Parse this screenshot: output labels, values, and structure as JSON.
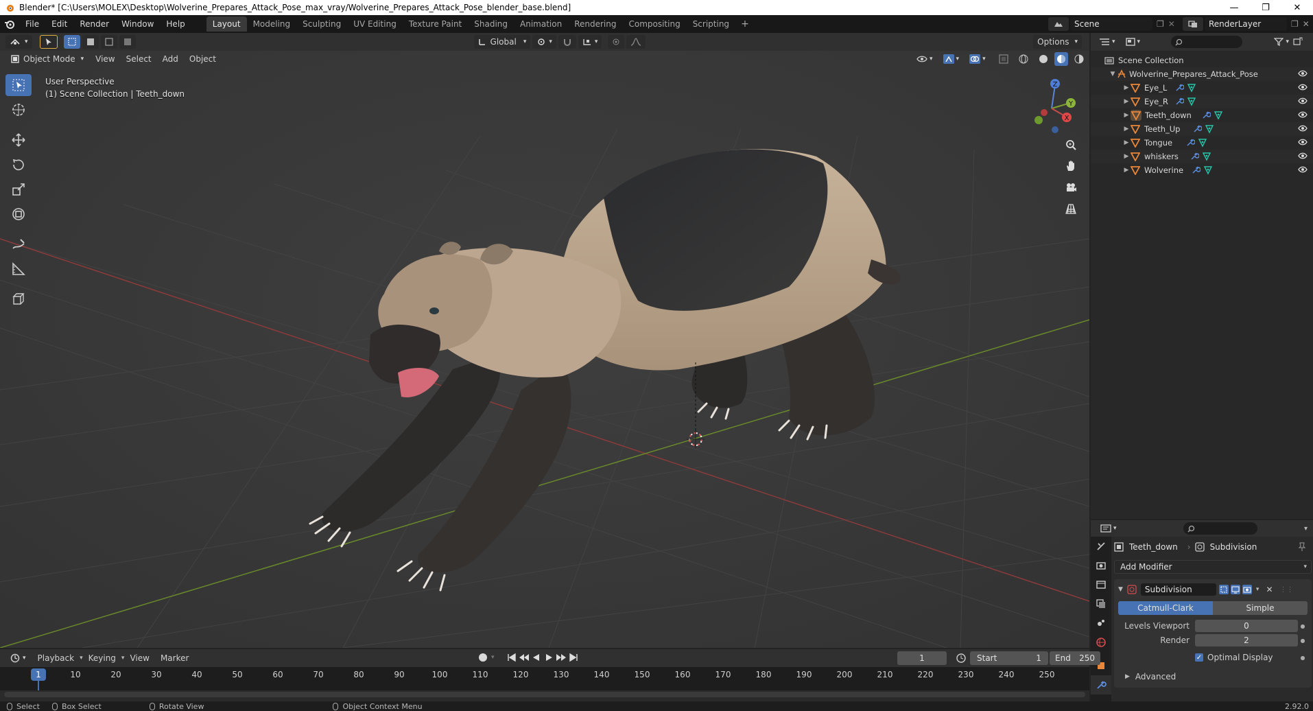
{
  "window": {
    "title": "Blender* [C:\\Users\\MOLEX\\Desktop\\Wolverine_Prepares_Attack_Pose_max_vray/Wolverine_Prepares_Attack_Pose_blender_base.blend]",
    "minimize": "—",
    "maximize": "❐",
    "close": "✕"
  },
  "menubar": {
    "items": [
      "File",
      "Edit",
      "Render",
      "Window",
      "Help"
    ],
    "workspaces": [
      "Layout",
      "Modeling",
      "Sculpting",
      "UV Editing",
      "Texture Paint",
      "Shading",
      "Animation",
      "Rendering",
      "Compositing",
      "Scripting"
    ],
    "active_workspace": "Layout",
    "add_tab": "+",
    "scene": "Scene",
    "render_layer": "RenderLayer"
  },
  "viewport": {
    "mode": "Object Mode",
    "menus": [
      "View",
      "Select",
      "Add",
      "Object"
    ],
    "orientation": "Global",
    "options": "Options",
    "info_line1": "User Perspective",
    "info_line2": "(1) Scene Collection | Teeth_down",
    "gizmo": {
      "z": "Z",
      "y": "Y",
      "x": "X"
    }
  },
  "outliner": {
    "root": "Scene Collection",
    "collection": "Wolverine_Prepares_Attack_Pose",
    "objects": [
      "Eye_L",
      "Eye_R",
      "Teeth_down",
      "Teeth_Up",
      "Tongue",
      "whiskers",
      "Wolverine"
    ]
  },
  "properties": {
    "object_name": "Teeth_down",
    "modifier_crumb": "Subdivision",
    "add_modifier": "Add Modifier",
    "modifier_name": "Subdivision",
    "mode_catmull": "Catmull-Clark",
    "mode_simple": "Simple",
    "levels_viewport_label": "Levels Viewport",
    "levels_viewport_value": "0",
    "render_label": "Render",
    "render_value": "2",
    "optimal_display": "Optimal Display",
    "advanced": "Advanced"
  },
  "timeline": {
    "menus": [
      "Playback",
      "Keying",
      "View",
      "Marker"
    ],
    "current_frame": "1",
    "start_label": "Start",
    "start_value": "1",
    "end_label": "End",
    "end_value": "250",
    "ticks": [
      "10",
      "20",
      "30",
      "40",
      "50",
      "60",
      "70",
      "80",
      "90",
      "100",
      "110",
      "120",
      "130",
      "140",
      "150",
      "160",
      "170",
      "180",
      "190",
      "200",
      "210",
      "220",
      "230",
      "240",
      "250"
    ],
    "cursor": "1"
  },
  "statusbar": {
    "select": "Select",
    "box_select": "Box Select",
    "rotate_view": "Rotate View",
    "context_menu": "Object Context Menu",
    "version": "2.92.0"
  },
  "colors": {
    "accent": "#4772b3",
    "x_axis": "#c0392b",
    "y_axis": "#6a9a22",
    "object_icon": "#e9873a",
    "mesh_icon": "#26c5a8",
    "modifier_icon": "#5c8ee0"
  }
}
